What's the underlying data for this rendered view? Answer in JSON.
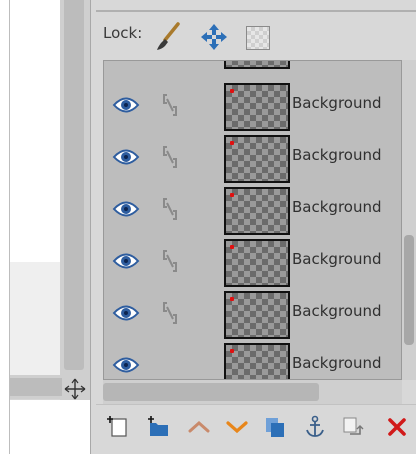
{
  "lock": {
    "label": "Lock:",
    "icons": [
      "paintbrush-icon",
      "move-arrows-icon",
      "alpha-checker-icon"
    ]
  },
  "layers": {
    "rows": [
      {
        "name": "Background",
        "visible": true,
        "linked": true
      },
      {
        "name": "Background",
        "visible": true,
        "linked": true
      },
      {
        "name": "Background",
        "visible": true,
        "linked": true
      },
      {
        "name": "Background",
        "visible": true,
        "linked": true
      },
      {
        "name": "Background",
        "visible": true,
        "linked": true
      },
      {
        "name": "Background",
        "visible": true,
        "linked": false
      }
    ]
  },
  "toolbar": {
    "buttons": [
      "new-layer-icon",
      "new-layer-group-icon",
      "raise-layer-icon",
      "lower-layer-icon",
      "duplicate-layer-icon",
      "anchor-layer-icon",
      "merge-down-icon",
      "delete-layer-icon"
    ]
  },
  "colors": {
    "eye": "#2e5d9f",
    "accent_orange": "#e8861a",
    "delete_red": "#d11a1a",
    "toolbar_blue": "#2c6fb7"
  }
}
